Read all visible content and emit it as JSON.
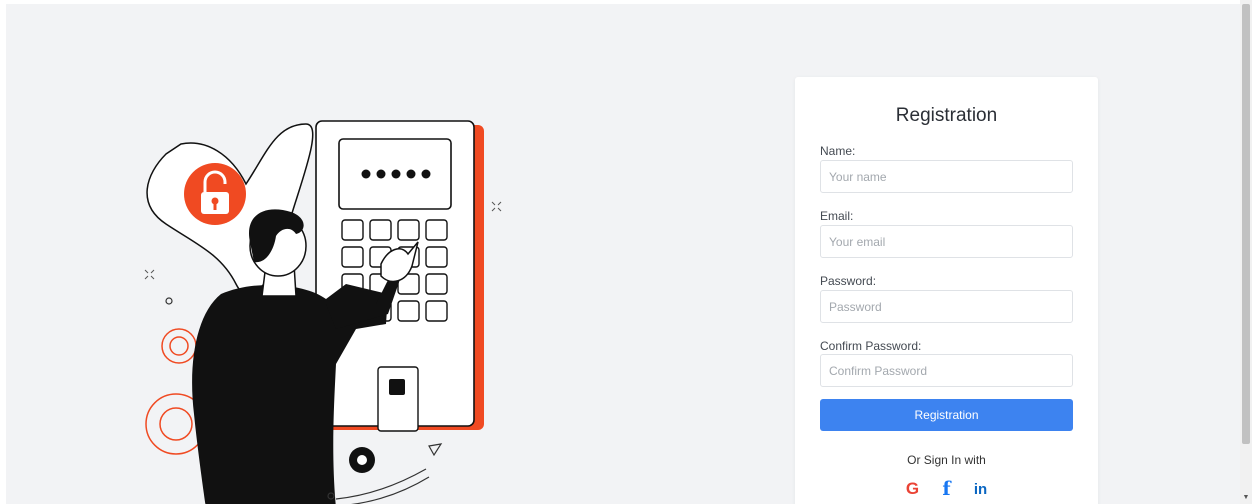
{
  "form": {
    "title": "Registration",
    "fields": [
      {
        "label": "Name:",
        "placeholder": "Your name",
        "value": ""
      },
      {
        "label": "Email:",
        "placeholder": "Your email",
        "value": ""
      },
      {
        "label": "Password:",
        "placeholder": "Password",
        "value": ""
      },
      {
        "label": "Confirm Password:",
        "placeholder": "Confirm Password",
        "value": ""
      }
    ],
    "submit_label": "Registration",
    "alt_signin_text": "Or Sign In with",
    "social": [
      {
        "glyph": "G",
        "icon": "google-icon",
        "color": "#ea4335"
      },
      {
        "glyph": "f",
        "icon": "facebook-icon",
        "color": "#1877f2"
      },
      {
        "glyph": "in",
        "icon": "linkedin-icon",
        "color": "#0a66c2"
      }
    ]
  },
  "theme": {
    "accent": "#3d83f0",
    "lock_badge": "#f04a22",
    "page_bg": "#f2f3f5"
  }
}
